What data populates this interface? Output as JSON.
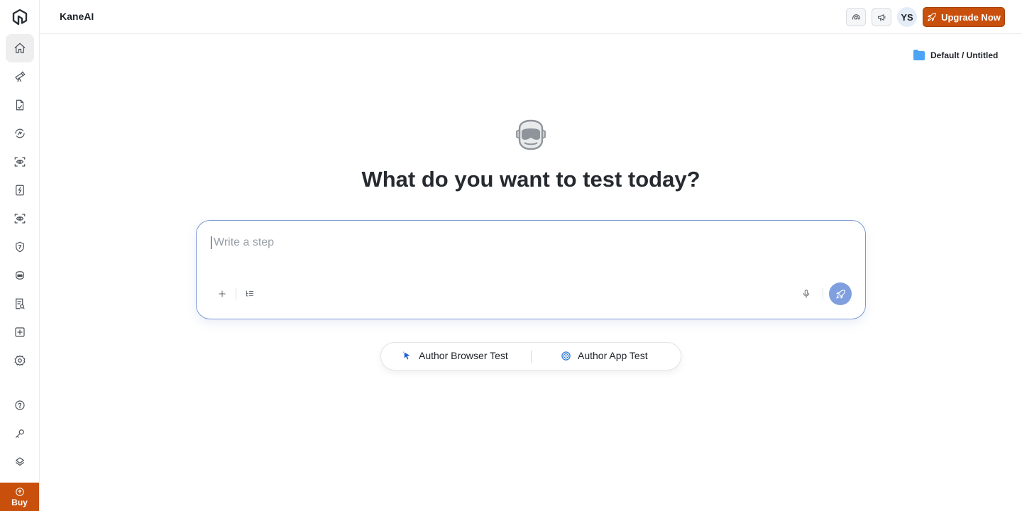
{
  "app": {
    "title": "KaneAI"
  },
  "sidebar": {
    "items": [
      {
        "name": "home",
        "icon": "home-icon",
        "active": true
      },
      {
        "name": "automation",
        "icon": "telescope-icon"
      },
      {
        "name": "test-manager",
        "icon": "document-icon"
      },
      {
        "name": "hyperexecute",
        "icon": "loop-icon"
      },
      {
        "name": "visual-testing",
        "icon": "eye-scan-icon"
      },
      {
        "name": "real-device",
        "icon": "bolt-icon"
      },
      {
        "name": "smart-ui",
        "icon": "eye-scan-icon"
      },
      {
        "name": "security",
        "icon": "shield-icon"
      },
      {
        "name": "kane-ai",
        "icon": "robot-icon"
      },
      {
        "name": "reports",
        "icon": "report-icon"
      },
      {
        "name": "add",
        "icon": "plus-square-icon"
      },
      {
        "name": "settings",
        "icon": "gear-icon"
      }
    ],
    "bottom_items": [
      {
        "name": "help",
        "icon": "help-icon"
      },
      {
        "name": "access-key",
        "icon": "key-icon"
      },
      {
        "name": "integrations",
        "icon": "layers-icon"
      }
    ],
    "buy_label": "Buy"
  },
  "header": {
    "avatar_initials": "YS",
    "upgrade_label": "Upgrade Now",
    "accent_color": "#c8500c"
  },
  "breadcrumb": {
    "label": "Default / Untitled"
  },
  "hero": {
    "title": "What do you want to test today?"
  },
  "prompt": {
    "placeholder": "Write a step",
    "value": ""
  },
  "modes": {
    "browser_label": "Author Browser Test",
    "app_label": "Author App Test"
  }
}
